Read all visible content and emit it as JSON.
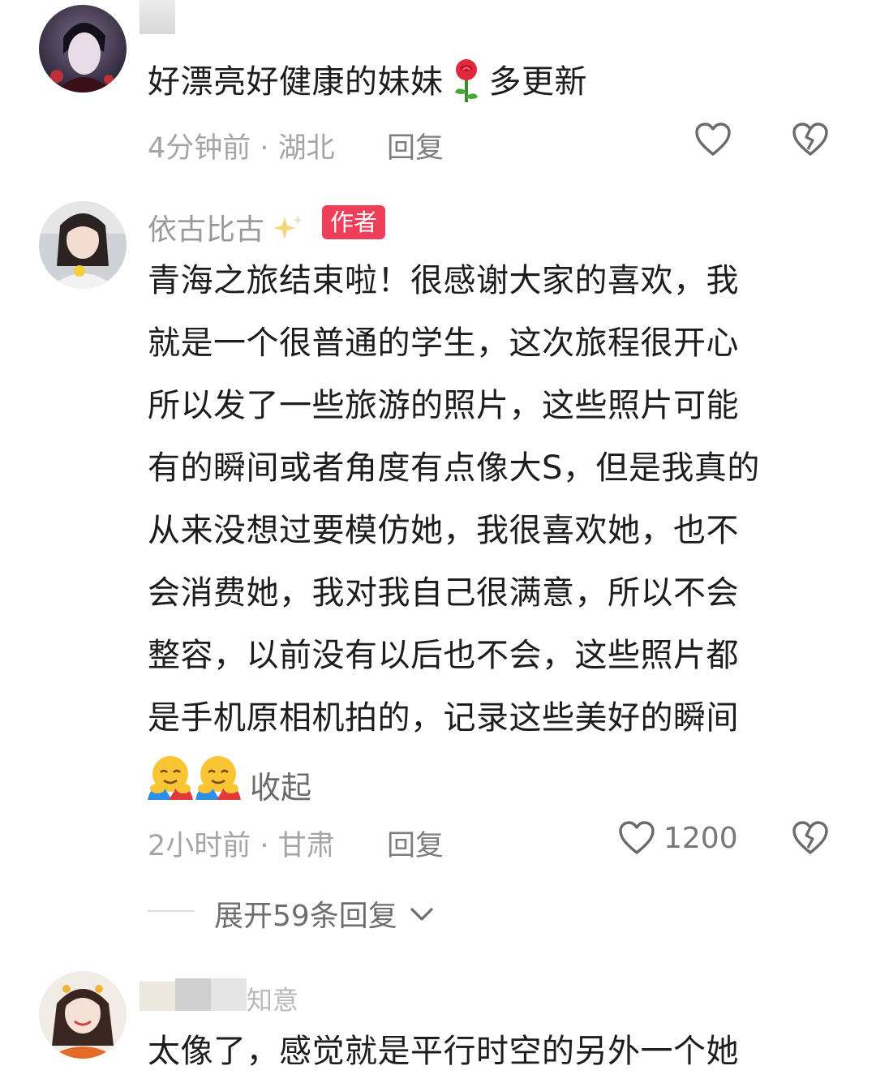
{
  "comments": [
    {
      "username": "",
      "text_main": "好漂亮好健康的妹妹",
      "text_tail": "多更新",
      "emoji": "rose-emoji",
      "time_location": "4分钟前 · 湖北",
      "reply_label": "回复",
      "avatar": "anime-character-avatar"
    },
    {
      "username": "依古比古",
      "author_badge": "作者",
      "lines": [
        "青海之旅结束啦！很感谢大家的喜欢，我",
        "就是一个很普通的学生，这次旅程很开心",
        "所以发了一些旅游的照片，这些照片可能",
        "有的瞬间或者角度有点像大S，但是我真的",
        "从来没想过要模仿她，我很喜欢她，也不",
        "会消费她，我对我自己很满意，所以不会",
        "整容，以前没有以后也不会，这些照片都",
        "是手机原相机拍的，记录这些美好的瞬间"
      ],
      "collapse_label": "收起",
      "emojis": [
        "hug-emoji",
        "hug-emoji"
      ],
      "time_location": "2小时前 · 甘肃",
      "reply_label": "回复",
      "like_count": "1200",
      "avatar": "girl-photo-avatar"
    },
    {
      "username": "知意",
      "text": "太像了，感觉就是平行时空的另外一个她",
      "avatar": "girl-smiling-avatar"
    }
  ],
  "expand_replies": "展开59条回复",
  "colors": {
    "author_badge": "#ee3f5a",
    "meta_text": "#a5a5a5",
    "body_text": "#1d1d1d"
  }
}
